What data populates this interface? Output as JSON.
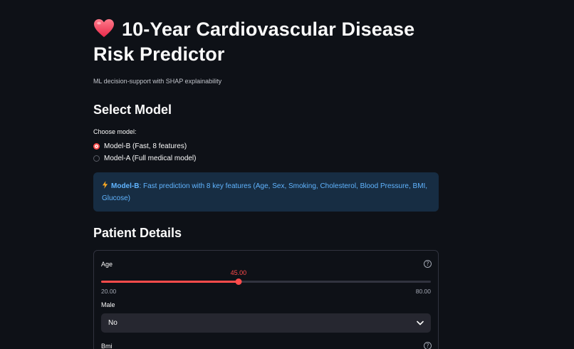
{
  "header": {
    "title": "10-Year Cardiovascular Disease Risk Predictor",
    "subtitle": "ML decision-support with SHAP explainability",
    "icon": "heart-icon"
  },
  "model_section": {
    "heading": "Select Model",
    "choose_label": "Choose model:",
    "options": [
      {
        "label": "Model-B (Fast, 8 features)",
        "selected": true
      },
      {
        "label": "Model-A (Full medical model)",
        "selected": false
      }
    ],
    "info": {
      "icon": "lightning-icon",
      "bold": "Model-B",
      "text": ": Fast prediction with 8 key features (Age, Sex, Smoking, Cholesterol, Blood Pressure, BMI, Glucose)"
    }
  },
  "patient_section": {
    "heading": "Patient Details",
    "age": {
      "label": "Age",
      "value": 45,
      "value_text": "45.00",
      "min": 20,
      "max": 80,
      "min_text": "20.00",
      "max_text": "80.00"
    },
    "male": {
      "label": "Male",
      "selected": "No"
    },
    "bmi": {
      "label": "Bmi"
    }
  },
  "colors": {
    "background": "#0e1117",
    "accent": "#ff4b4b",
    "info_bg": "#172d43",
    "info_text": "#60b4ff"
  }
}
